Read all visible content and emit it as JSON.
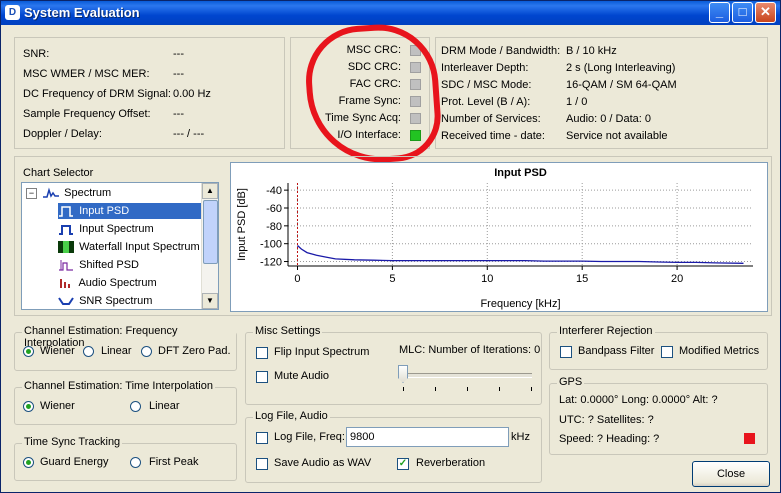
{
  "window": {
    "title": "System Evaluation",
    "app_icon": "D"
  },
  "titlebar_buttons": {
    "minimize": "_",
    "maximize": "□",
    "close": "✕"
  },
  "left_status": {
    "rows": [
      {
        "label": "SNR:",
        "value": "---"
      },
      {
        "label": "MSC WMER / MSC MER:",
        "value": "---"
      },
      {
        "label": "DC Frequency of DRM Signal:",
        "value": "0.00 Hz"
      },
      {
        "label": "Sample Frequency Offset:",
        "value": "---"
      },
      {
        "label": "Doppler / Delay:",
        "value": "--- / ---"
      }
    ]
  },
  "indicators": {
    "rows": [
      {
        "label": "MSC CRC:",
        "state": "grey"
      },
      {
        "label": "SDC CRC:",
        "state": "grey"
      },
      {
        "label": "FAC CRC:",
        "state": "grey"
      },
      {
        "label": "Frame Sync:",
        "state": "grey"
      },
      {
        "label": "Time Sync Acq:",
        "state": "grey"
      },
      {
        "label": "I/O Interface:",
        "state": "green"
      }
    ]
  },
  "drm_info": {
    "rows": [
      {
        "label": "DRM Mode / Bandwidth:",
        "value": "B / 10 kHz"
      },
      {
        "label": "Interleaver Depth:",
        "value": "2 s (Long Interleaving)"
      },
      {
        "label": "SDC / MSC Mode:",
        "value": "16-QAM / SM 64-QAM"
      },
      {
        "label": "Prot. Level (B / A):",
        "value": "1 / 0"
      },
      {
        "label": "Number of Services:",
        "value": "Audio: 0 / Data: 0"
      },
      {
        "label": "Received time - date:",
        "value": "Service not available"
      }
    ]
  },
  "chart_selector": {
    "title": "Chart Selector",
    "root": "Spectrum",
    "items": [
      {
        "label": "Input PSD",
        "icon": "psd-icon",
        "selected": true
      },
      {
        "label": "Input Spectrum",
        "icon": "input-spectrum-icon",
        "selected": false
      },
      {
        "label": "Waterfall Input Spectrum",
        "icon": "waterfall-icon",
        "selected": false
      },
      {
        "label": "Shifted PSD",
        "icon": "shifted-psd-icon",
        "selected": false
      },
      {
        "label": "Audio Spectrum",
        "icon": "audio-spectrum-icon",
        "selected": false
      },
      {
        "label": "SNR Spectrum",
        "icon": "snr-spectrum-icon",
        "selected": false
      }
    ]
  },
  "chart_data": {
    "type": "line",
    "title": "Input PSD",
    "xlabel": "Frequency [kHz]",
    "ylabel": "Input PSD [dB]",
    "xlim": [
      -0.5,
      24
    ],
    "ylim": [
      -125,
      -32
    ],
    "xticks": [
      0,
      5,
      10,
      15,
      20
    ],
    "yticks": [
      -40,
      -60,
      -80,
      -100,
      -120
    ],
    "grid": true,
    "series": [
      {
        "color": "#1a1aa8",
        "x": [
          0,
          0.2,
          0.5,
          1,
          1.5,
          2,
          3,
          4,
          5,
          6,
          7,
          8,
          9,
          10,
          11,
          12,
          13,
          14,
          15,
          16,
          17,
          18,
          19,
          20,
          21,
          22,
          23.5
        ],
        "y": [
          -102,
          -106,
          -110,
          -113,
          -115,
          -117,
          -118,
          -118.5,
          -119,
          -119,
          -119,
          -119,
          -119,
          -119,
          -119,
          -119,
          -119.5,
          -119.5,
          -119.5,
          -120,
          -120,
          -120,
          -120.5,
          -121,
          -121,
          -121.5,
          -122
        ]
      }
    ],
    "marker_x": 0
  },
  "freq_interp": {
    "title": "Channel Estimation: Frequency Interpolation",
    "options": [
      {
        "label": "Wiener",
        "selected": true
      },
      {
        "label": "Linear",
        "selected": false
      },
      {
        "label": "DFT Zero Pad.",
        "selected": false
      }
    ]
  },
  "time_interp": {
    "title": "Channel Estimation: Time Interpolation",
    "options": [
      {
        "label": "Wiener",
        "selected": true
      },
      {
        "label": "Linear",
        "selected": false
      }
    ]
  },
  "time_sync": {
    "title": "Time Sync Tracking",
    "options": [
      {
        "label": "Guard Energy",
        "selected": true
      },
      {
        "label": "First Peak",
        "selected": false
      }
    ]
  },
  "misc": {
    "title": "Misc Settings",
    "flip_label": "Flip Input Spectrum",
    "flip_checked": false,
    "mute_label": "Mute Audio",
    "mute_checked": false,
    "mlc_label": "MLC: Number of Iterations: 0",
    "mlc_value": 0
  },
  "logfile": {
    "title": "Log File, Audio",
    "log_label": "Log File, Freq:",
    "log_checked": false,
    "freq_value": "9800",
    "unit": "kHz",
    "save_label": "Save Audio as WAV",
    "save_checked": false,
    "reverb_label": "Reverberation",
    "reverb_checked": true
  },
  "interferer": {
    "title": "Interferer Rejection",
    "bandpass_label": "Bandpass Filter",
    "modified_label": "Modified Metrics"
  },
  "gps": {
    "title": "GPS",
    "line1": "Lat: 0.0000°  Long: 0.0000°  Alt: ?",
    "line2": "UTC: ?  Satellites: ?",
    "line3": "Speed: ?  Heading: ?",
    "status_color": "#e8141c"
  },
  "close_button": "Close"
}
